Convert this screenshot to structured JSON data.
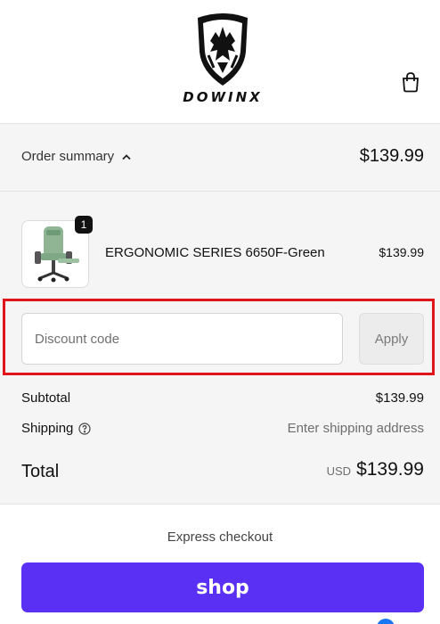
{
  "header": {
    "brand": "DOWINX",
    "icons": {
      "logo": "dowinx-shield-logo",
      "cart": "shopping-bag-icon"
    }
  },
  "summary": {
    "toggle_label": "Order summary",
    "toggle_icon": "chevron-up-icon",
    "total": "$139.99"
  },
  "product": {
    "quantity": "1",
    "name": "ERGONOMIC SERIES 6650F-Green",
    "price": "$139.99",
    "image_icon": "gaming-chair-image"
  },
  "discount": {
    "placeholder": "Discount code",
    "value": "",
    "apply_label": "Apply",
    "highlight_color": "#e0141b"
  },
  "totals": {
    "subtotal_label": "Subtotal",
    "subtotal_value": "$139.99",
    "shipping_label": "Shipping",
    "shipping_icon": "help-circle-icon",
    "shipping_value": "Enter shipping address",
    "total_label": "Total",
    "currency": "USD",
    "total_value": "$139.99"
  },
  "checkout": {
    "express_label": "Express checkout",
    "shop_label": "shop",
    "shop_color": "#5a31f4"
  }
}
